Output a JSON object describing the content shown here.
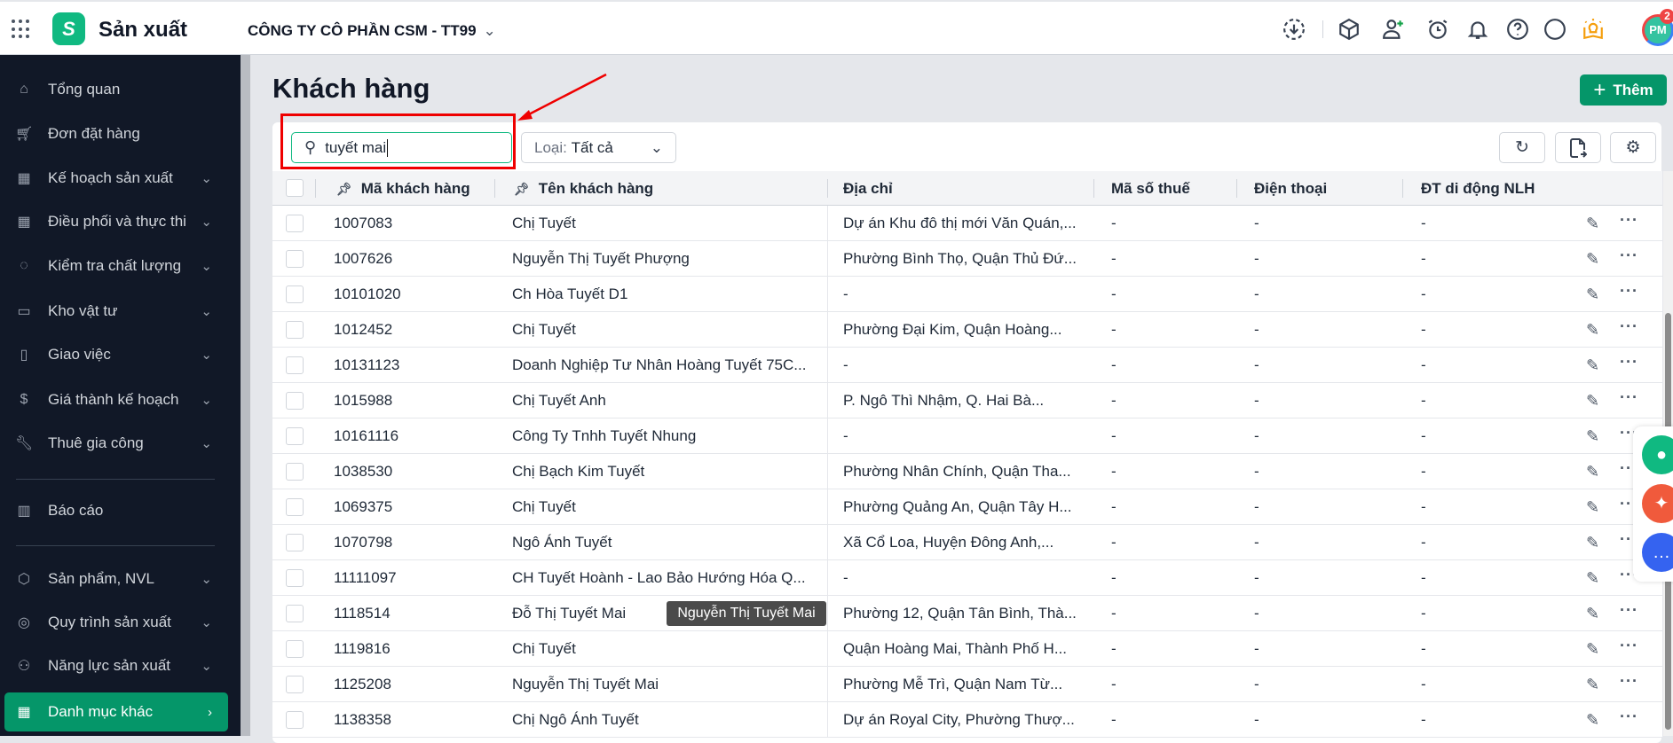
{
  "header": {
    "app_title": "Sản xuất",
    "company": "CÔNG TY CÔ PHẦN CSM - TT99",
    "avatar_initials": "PM",
    "notification_count": "2",
    "icons": [
      "download-icon",
      "box-icon",
      "add-user-icon",
      "alarm-icon",
      "bell-icon",
      "help-icon",
      "more-icon",
      "bulb-book-icon"
    ]
  },
  "sidebar": {
    "items": [
      {
        "label": "Tổng quan",
        "icon": "home-icon",
        "expandable": false
      },
      {
        "label": "Đơn đặt hàng",
        "icon": "cart-icon",
        "expandable": false
      },
      {
        "label": "Kế hoạch sản xuất",
        "icon": "calendar-icon",
        "expandable": true
      },
      {
        "label": "Điều phối và thực thi",
        "icon": "calendar-gear-icon",
        "expandable": true
      },
      {
        "label": "Kiểm tra chất lượng",
        "icon": "check-circle-icon",
        "expandable": true
      },
      {
        "label": "Kho vật tư",
        "icon": "archive-icon",
        "expandable": true
      },
      {
        "label": "Giao việc",
        "icon": "clipboard-icon",
        "expandable": true
      },
      {
        "label": "Giá thành kế hoạch",
        "icon": "cost-icon",
        "expandable": true
      },
      {
        "label": "Thuê gia công",
        "icon": "wrench-icon",
        "expandable": true
      },
      {
        "label": "Báo cáo",
        "icon": "chart-icon",
        "expandable": false
      },
      {
        "label": "Sản phẩm, NVL",
        "icon": "cube-icon",
        "expandable": true
      },
      {
        "label": "Quy trình sản xuất",
        "icon": "process-icon",
        "expandable": true
      },
      {
        "label": "Năng lực sản xuất",
        "icon": "capacity-icon",
        "expandable": true
      },
      {
        "label": "Danh mục khác",
        "icon": "grid-icon",
        "expandable": true,
        "active": true
      }
    ]
  },
  "main": {
    "title": "Khách hàng",
    "add_label": "Thêm",
    "search_value": "tuyết mai",
    "filter_label": "Loại:",
    "filter_value": "Tất cả",
    "columns": [
      "Mã khách hàng",
      "Tên khách hàng",
      "Địa chỉ",
      "Mã số thuế",
      "Điện thoại",
      "ĐT di động NLH"
    ],
    "rows": [
      [
        "1007083",
        "Chị Tuyết",
        "Dự án Khu đô thị mới Văn Quán,...",
        "-",
        "-",
        "-"
      ],
      [
        "1007626",
        "Nguyễn Thị Tuyết Phượng",
        "Phường Bình Thọ, Quận Thủ Đứ...",
        "-",
        "-",
        "-"
      ],
      [
        "10101020",
        "Ch Hòa Tuyết D1",
        "-",
        "-",
        "-",
        "-"
      ],
      [
        "1012452",
        "Chị Tuyết",
        "Phường Đại Kim, Quận Hoàng...",
        "-",
        "-",
        "-"
      ],
      [
        "10131123",
        "Doanh Nghiệp Tư Nhân Hoàng Tuyết 75C...",
        "-",
        "-",
        "-",
        "-"
      ],
      [
        "1015988",
        "Chị Tuyết Anh",
        "P. Ngô Thì Nhậm, Q. Hai Bà...",
        "-",
        "-",
        "-"
      ],
      [
        "10161116",
        "Công Ty Tnhh Tuyết Nhung",
        "-",
        "-",
        "-",
        "-"
      ],
      [
        "1038530",
        "Chị Bạch Kim Tuyết",
        "Phường Nhân Chính, Quận Tha...",
        "-",
        "-",
        "-"
      ],
      [
        "1069375",
        "Chị Tuyết",
        "Phường Quảng An, Quận Tây H...",
        "-",
        "-",
        "-"
      ],
      [
        "1070798",
        "Ngô Ánh Tuyết",
        "Xã Cổ Loa, Huyện Đông Anh,...",
        "-",
        "-",
        "-"
      ],
      [
        "11111097",
        "CH Tuyết Hoành - Lao Bảo Hướng Hóa Q...",
        "-",
        "-",
        "-",
        "-"
      ],
      [
        "1118514",
        "Đỗ Thị Tuyết Mai",
        "Phường 12, Quận Tân Bình, Thà...",
        "-",
        "-",
        "-"
      ],
      [
        "1119816",
        "Chị Tuyết",
        "Quận Hoàng Mai, Thành Phố H...",
        "-",
        "-",
        "-"
      ],
      [
        "1125208",
        "Nguyễn Thị Tuyết Mai",
        "Phường Mễ Trì, Quận Nam Từ...",
        "-",
        "-",
        "-"
      ],
      [
        "1138358",
        "Chị Ngô Ánh Tuyết",
        "Dự án Royal City, Phường Thượ...",
        "-",
        "-",
        "-"
      ]
    ],
    "tooltip": "Nguyễn Thị Tuyết Mai"
  },
  "colors": {
    "accent": "#059669",
    "sidebar": "#111827",
    "highlight": "#ef0000"
  }
}
